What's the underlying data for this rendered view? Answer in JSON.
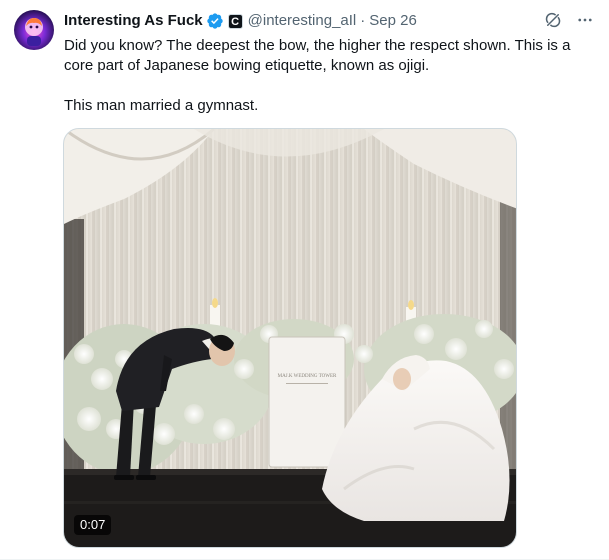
{
  "tweet": {
    "author": {
      "display_name": "Interesting As Fuck",
      "handle": "@interesting_aIl",
      "verified_icon": "verified-badge-icon",
      "affiliate_badge_letter": "C",
      "avatar_icon": "avatar-icon"
    },
    "separator": "·",
    "date": "Sep 26",
    "actions": {
      "grok_icon": "grok-icon",
      "more_icon": "more-icon"
    },
    "text": {
      "line1": "Did you know? The deepest the bow, the higher the respect shown. This is a core part of Japanese bowing etiquette, known as ojigi.",
      "line2": "This man married a gymnast."
    },
    "media": {
      "type": "video",
      "duration": "0:07",
      "sign_title": "MAJ.K WEDDING TOWER"
    }
  },
  "colors": {
    "text_primary": "#0f1419",
    "text_secondary": "#536471",
    "verified_blue": "#1d9bf0",
    "border": "#cfd9de"
  }
}
